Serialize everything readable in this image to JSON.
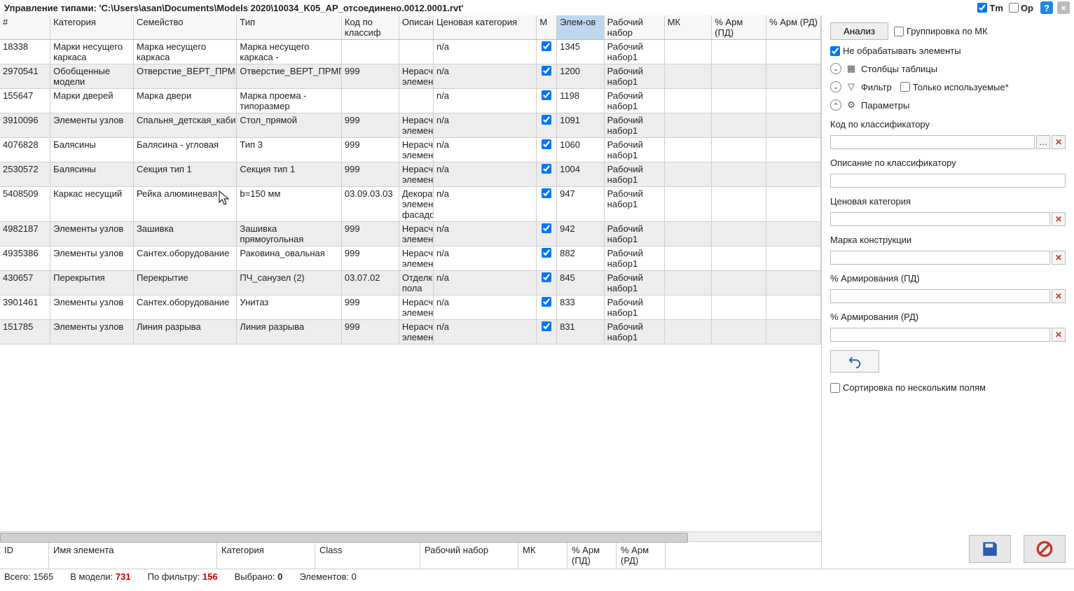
{
  "title": "Управление типами: 'C:\\Users\\asan\\Documents\\Models 2020\\10034_K05_АР_отсоединено.0012.0001.rvt'",
  "titlebar": {
    "tm": "Tm",
    "op": "Op"
  },
  "columns": [
    "#",
    "Категория",
    "Семейство",
    "Тип",
    "Код по классиф",
    "Описание",
    "Ценовая категория",
    "М",
    "Элем-ов",
    "Рабочий набор",
    "МК",
    "% Арм (ПД)",
    "% Арм (РД)"
  ],
  "rows": [
    {
      "id": "18338",
      "cat": "Марки несущего каркаса",
      "fam": "Марка несущего каркаса",
      "type": "Марка несущего каркаса -",
      "code": "",
      "desc": "",
      "price": "n/a",
      "m": true,
      "elem": "1345",
      "wset": "Рабочий набор1"
    },
    {
      "id": "2970541",
      "cat": "Обобщенные модели",
      "fam": "Отверстие_ВЕРТ_ПРМГ",
      "type": "Отверстие_ВЕРТ_ПРМГ",
      "code": "999",
      "desc": "Нерасчетные элементы",
      "price": "n/a",
      "m": true,
      "elem": "1200",
      "wset": "Рабочий набор1"
    },
    {
      "id": "155647",
      "cat": "Марки дверей",
      "fam": "Марка двери",
      "type": "Марка проема - типоразмер",
      "code": "",
      "desc": "",
      "price": "n/a",
      "m": true,
      "elem": "1198",
      "wset": "Рабочий набор1"
    },
    {
      "id": "3910096",
      "cat": "Элементы узлов",
      "fam": "Спальня_детская_кабинет",
      "type": "Стол_прямой",
      "code": "999",
      "desc": "Нерасчетные элементы",
      "price": "n/a",
      "m": true,
      "elem": "1091",
      "wset": "Рабочий набор1"
    },
    {
      "id": "4076828",
      "cat": "Балясины",
      "fam": "Балясина - угловая",
      "type": "Тип 3",
      "code": "999",
      "desc": "Нерасчетные элементы",
      "price": "n/a",
      "m": true,
      "elem": "1060",
      "wset": "Рабочий набор1"
    },
    {
      "id": "2530572",
      "cat": "Балясины",
      "fam": "Секция тип 1",
      "type": "Секция тип 1",
      "code": "999",
      "desc": "Нерасчетные элементы",
      "price": "n/a",
      "m": true,
      "elem": "1004",
      "wset": "Рабочий набор1"
    },
    {
      "id": "5408509",
      "cat": "Каркас несущий",
      "fam": "Рейка алюминевая",
      "type": "b=150 мм",
      "code": "03.09.03.03",
      "desc": "Декоративные элементы фасадов",
      "price": "n/a",
      "m": true,
      "elem": "947",
      "wset": "Рабочий набор1"
    },
    {
      "id": "4982187",
      "cat": "Элементы узлов",
      "fam": "Зашивка",
      "type": "Зашивка прямоугольная",
      "code": "999",
      "desc": "Нерасчетные элементы",
      "price": "n/a",
      "m": true,
      "elem": "942",
      "wset": "Рабочий набор1"
    },
    {
      "id": "4935386",
      "cat": "Элементы узлов",
      "fam": "Сантех.оборудование",
      "type": "Раковина_овальная",
      "code": "999",
      "desc": "Нерасчетные элементы",
      "price": "n/a",
      "m": true,
      "elem": "882",
      "wset": "Рабочий набор1"
    },
    {
      "id": "430657",
      "cat": "Перекрытия",
      "fam": "Перекрытие",
      "type": "ПЧ_санузел (2)",
      "code": "03.07.02",
      "desc": "Отделка пола",
      "price": "n/a",
      "m": true,
      "elem": "845",
      "wset": "Рабочий набор1"
    },
    {
      "id": "3901461",
      "cat": "Элементы узлов",
      "fam": "Сантех.оборудование",
      "type": "Унитаз",
      "code": "999",
      "desc": "Нерасчетные элементы",
      "price": "n/a",
      "m": true,
      "elem": "833",
      "wset": "Рабочий набор1"
    },
    {
      "id": "151785",
      "cat": "Элементы узлов",
      "fam": "Линия разрыва",
      "type": "Линия разрыва",
      "code": "999",
      "desc": "Нерасчетные элементы",
      "price": "n/a",
      "m": true,
      "elem": "831",
      "wset": "Рабочий набор1"
    }
  ],
  "detail_cols": [
    "ID",
    "Имя элемента",
    "Категория",
    "Class",
    "Рабочий набор",
    "МК",
    "% Арм (ПД)",
    "% Арм (РД)"
  ],
  "status": {
    "total_lbl": "Всего:",
    "total": "1565",
    "model_lbl": "В модели:",
    "model": "731",
    "filter_lbl": "По фильтру:",
    "filter": "156",
    "sel_lbl": "Выбрано:",
    "sel": "0",
    "elem_lbl": "Элементов:",
    "elem": "0"
  },
  "right": {
    "analiz": "Анализ",
    "group_mk": "Группировка по МК",
    "no_proc": "Не обрабатывать элементы",
    "sec_cols": "Столбцы таблицы",
    "sec_filter": "Фильтр",
    "only_used": "Только используемые*",
    "sec_param": "Параметры",
    "p_code": "Код по классификатору",
    "p_desc": "Описание по классификатору",
    "p_price": "Ценовая категория",
    "p_mk": "Марка конструкции",
    "p_arm_pd": "% Армирования (ПД)",
    "p_arm_rd": "% Армирования (РД)",
    "sort_multi": "Сортировка по нескольким полям"
  }
}
